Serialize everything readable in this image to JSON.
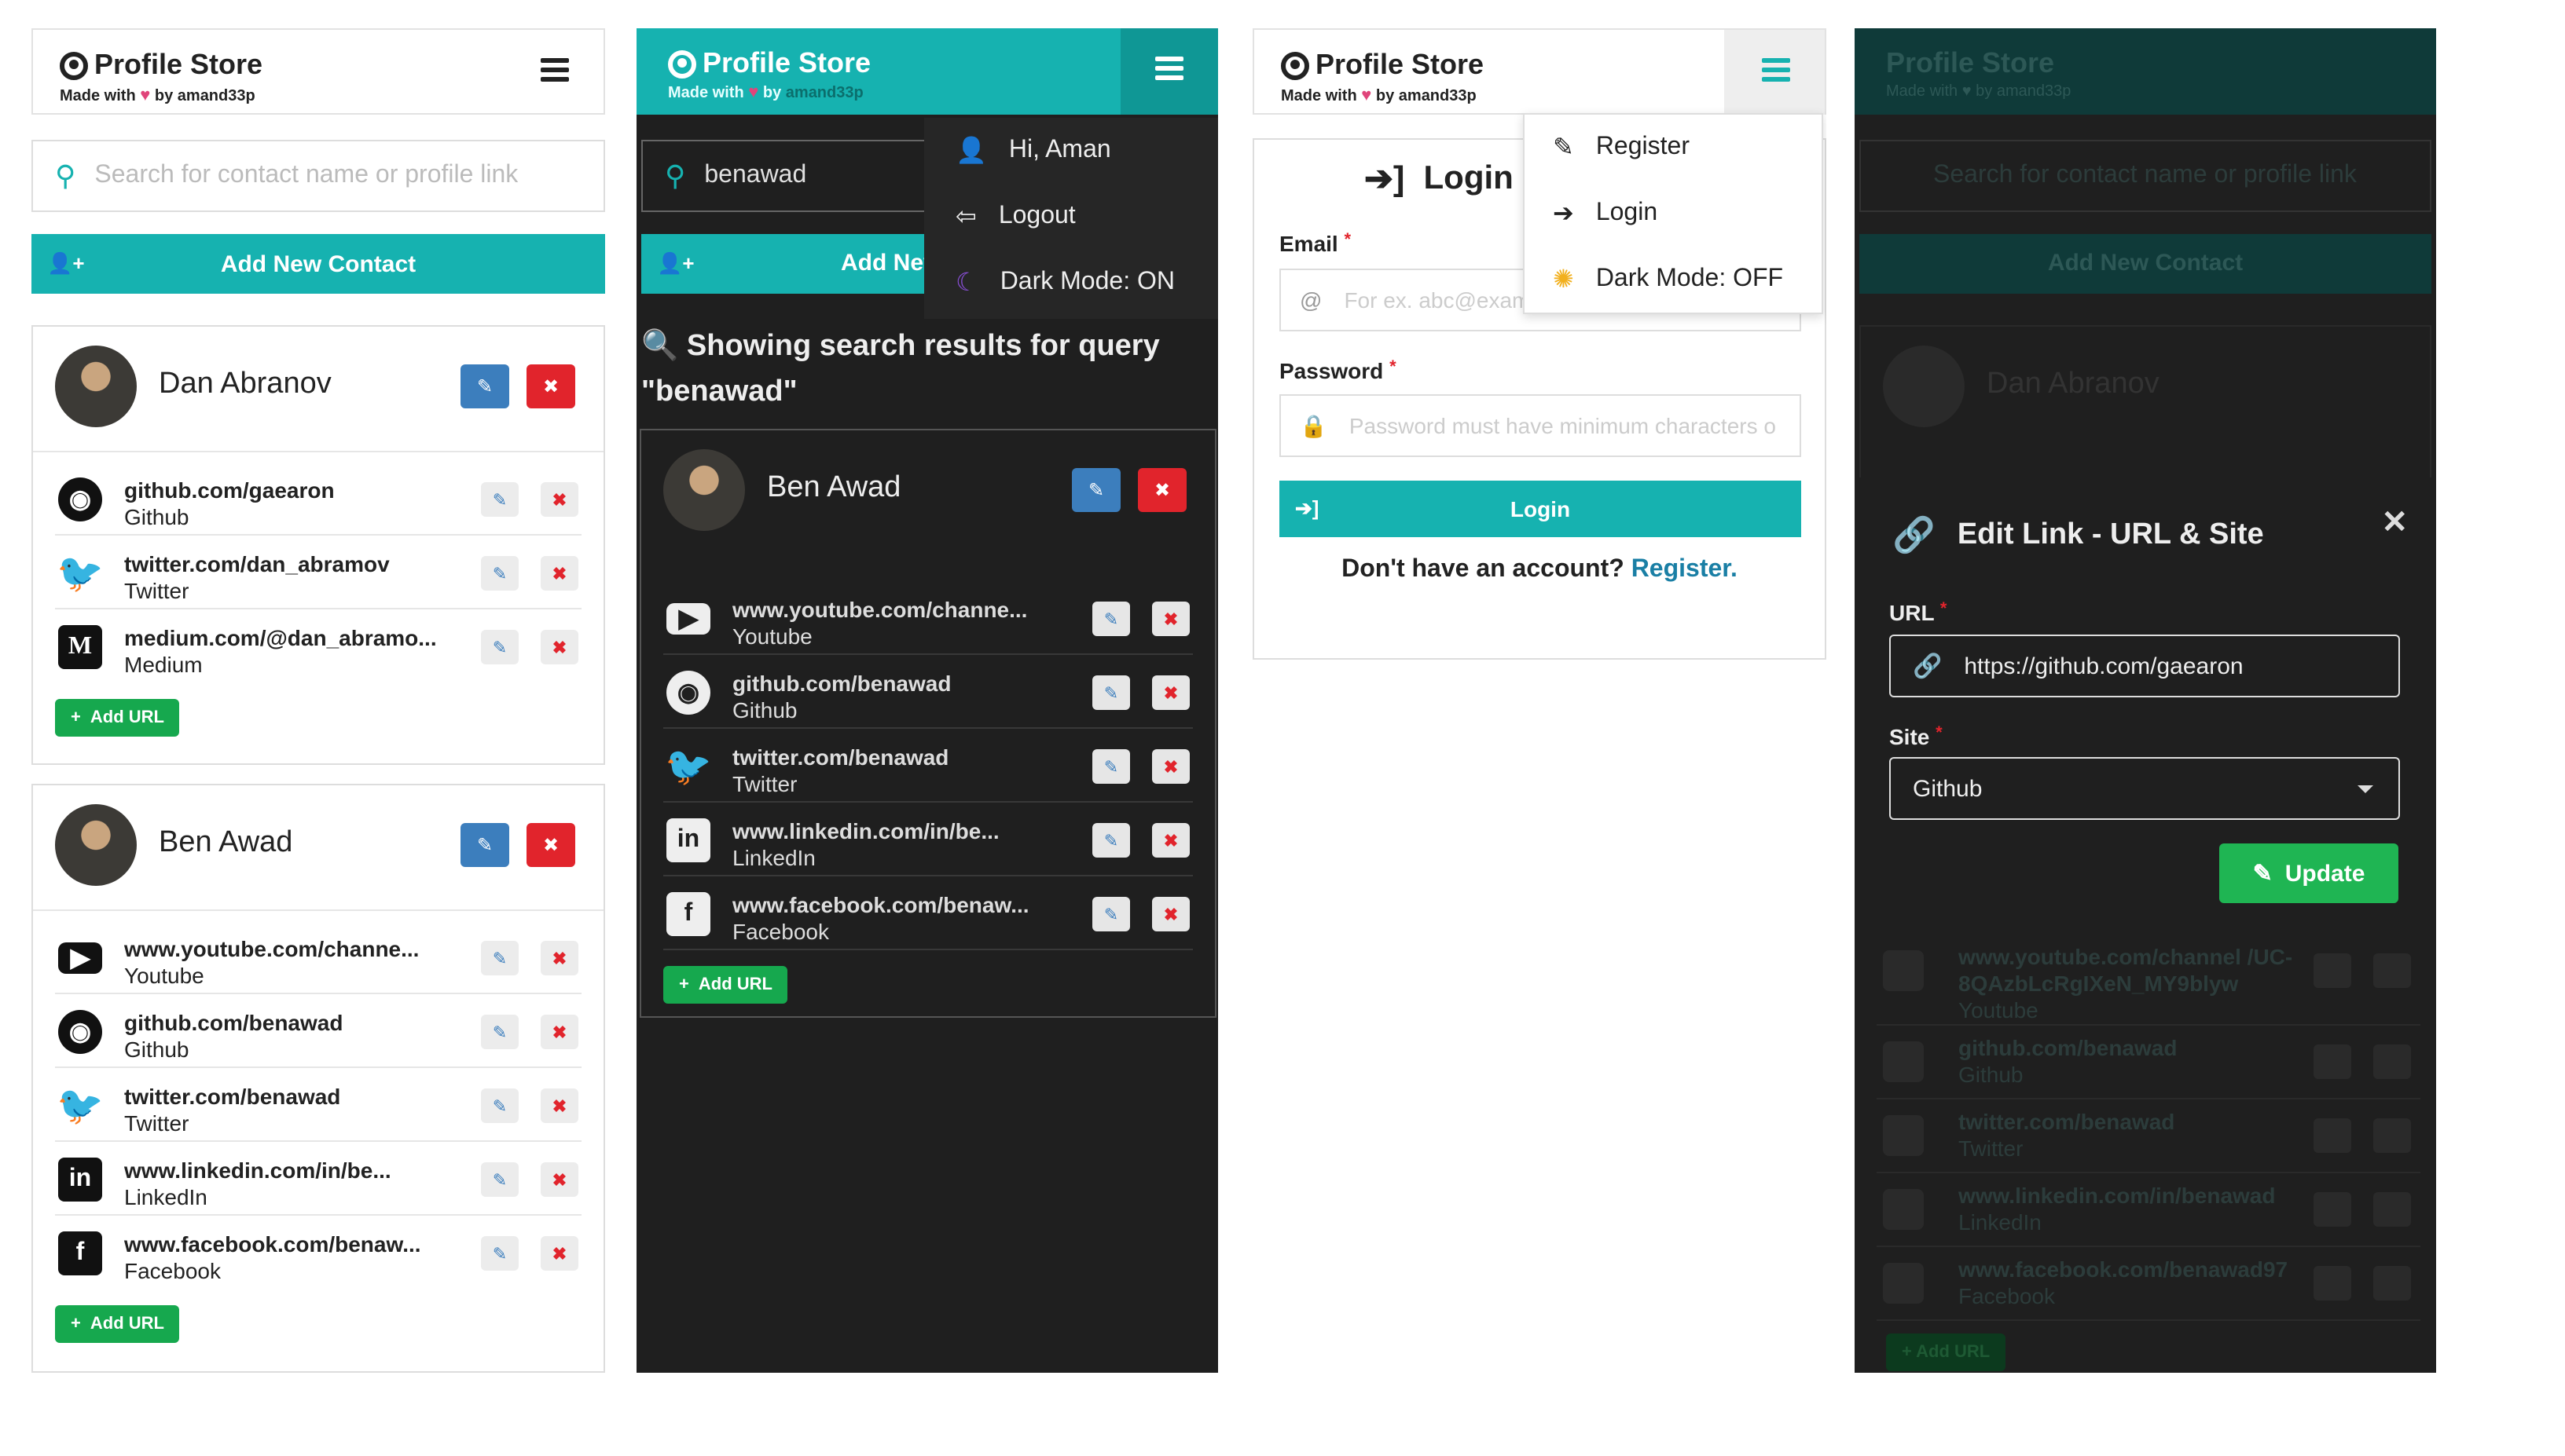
{
  "app": {
    "title": "Profile Store",
    "made_with": "Made with",
    "by": "by",
    "author": "amand33p"
  },
  "search": {
    "placeholder": "Search for contact name or profile link",
    "query_value": "benawad"
  },
  "add_contact_label": "Add New Contact",
  "add_contact_label_short": "Add Nev",
  "add_url_label": "Add URL",
  "contacts": [
    {
      "name": "Dan Abranov",
      "links": [
        {
          "url": "github.com/gaearon",
          "site": "Github",
          "icon": "github-icon"
        },
        {
          "url": "twitter.com/dan_abramov",
          "site": "Twitter",
          "icon": "twitter-icon"
        },
        {
          "url": "medium.com/@dan_abramo...",
          "site": "Medium",
          "icon": "medium-icon"
        }
      ]
    },
    {
      "name": "Ben Awad",
      "links": [
        {
          "url": "www.youtube.com/channe...",
          "site": "Youtube",
          "icon": "youtube-icon"
        },
        {
          "url": "github.com/benawad",
          "site": "Github",
          "icon": "github-icon"
        },
        {
          "url": "twitter.com/benawad",
          "site": "Twitter",
          "icon": "twitter-icon"
        },
        {
          "url": "www.linkedin.com/in/be...",
          "site": "LinkedIn",
          "icon": "linkedin-icon"
        },
        {
          "url": "www.facebook.com/benaw...",
          "site": "Facebook",
          "icon": "facebook-icon"
        }
      ]
    }
  ],
  "dark_menu": {
    "greeting": "Hi, Aman",
    "logout": "Logout",
    "dark_mode": "Dark Mode: ON"
  },
  "search_results": {
    "heading": "Showing search results for query",
    "query": "\"benawad\""
  },
  "login": {
    "title": "Login t",
    "email_label": "Email",
    "email_placeholder": "For ex. abc@exam",
    "password_label": "Password",
    "password_placeholder": "Password must have minimum characters o",
    "button": "Login",
    "no_account": "Don't have an account?",
    "register_link": "Register."
  },
  "light_menu": {
    "register": "Register",
    "login": "Login",
    "dark_mode": "Dark Mode: OFF"
  },
  "edit_modal": {
    "title": "Edit Link - URL & Site",
    "url_label": "URL",
    "url_value": "https://github.com/gaearon",
    "site_label": "Site",
    "site_value": "Github",
    "update_button": "Update"
  },
  "background_links": [
    {
      "url": "www.youtube.com/channel /UC-8QAzbLcRgIXeN_MY9blyw",
      "site": "Youtube"
    },
    {
      "url": "github.com/benawad",
      "site": "Github"
    },
    {
      "url": "twitter.com/benawad",
      "site": "Twitter"
    },
    {
      "url": "www.linkedin.com/in/benawad",
      "site": "LinkedIn"
    },
    {
      "url": "www.facebook.com/benawad97",
      "site": "Facebook"
    }
  ],
  "colors": {
    "teal": "#16b2b0",
    "edit_blue": "#3c7ebd",
    "delete_red": "#e1242c",
    "green": "#16a84e",
    "dark_bg": "#1f1f1f"
  }
}
